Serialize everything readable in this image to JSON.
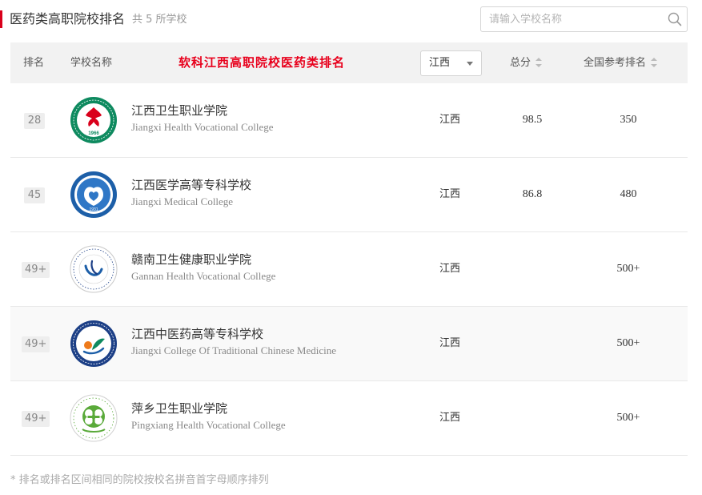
{
  "header": {
    "title": "医药类高职院校排名",
    "count": "共 5 所学校"
  },
  "search": {
    "placeholder": "请输入学校名称"
  },
  "table": {
    "columns": {
      "rank": "排名",
      "name": "学校名称",
      "banner": "软科江西高职院校医药类排名",
      "province_filter": "江西",
      "score": "总分",
      "national_rank": "全国参考排名"
    },
    "rows": [
      {
        "rank": "28",
        "name_cn": "江西卫生职业学院",
        "name_en": "Jiangxi Health Vocational College",
        "province": "江西",
        "score": "98.5",
        "national_rank": "350",
        "logo_text": "1966"
      },
      {
        "rank": "45",
        "name_cn": "江西医学高等专科学校",
        "name_en": "Jiangxi Medical College",
        "province": "江西",
        "score": "86.8",
        "national_rank": "480",
        "logo_text": "1931"
      },
      {
        "rank": "49+",
        "name_cn": "赣南卫生健康职业学院",
        "name_en": "Gannan Health Vocational College",
        "province": "江西",
        "score": "",
        "national_rank": "500+"
      },
      {
        "rank": "49+",
        "name_cn": "江西中医药高等专科学校",
        "name_en": "Jiangxi College Of Traditional Chinese Medicine",
        "province": "江西",
        "score": "",
        "national_rank": "500+"
      },
      {
        "rank": "49+",
        "name_cn": "萍乡卫生职业学院",
        "name_en": "Pingxiang Health Vocational College",
        "province": "江西",
        "score": "",
        "national_rank": "500+"
      }
    ]
  },
  "footnote": "* 排名或排名区间相同的院校按校名拼音首字母顺序排列",
  "colors": {
    "accent_red": "#d9001b",
    "banner_red": "#e8001c",
    "logo_green": "#0e8a5f",
    "logo_blue": "#1d5fa8",
    "logo_navy": "#1c3f86",
    "logo_orange": "#ee7a1a",
    "logo_lightgreen": "#5aaa3a"
  }
}
